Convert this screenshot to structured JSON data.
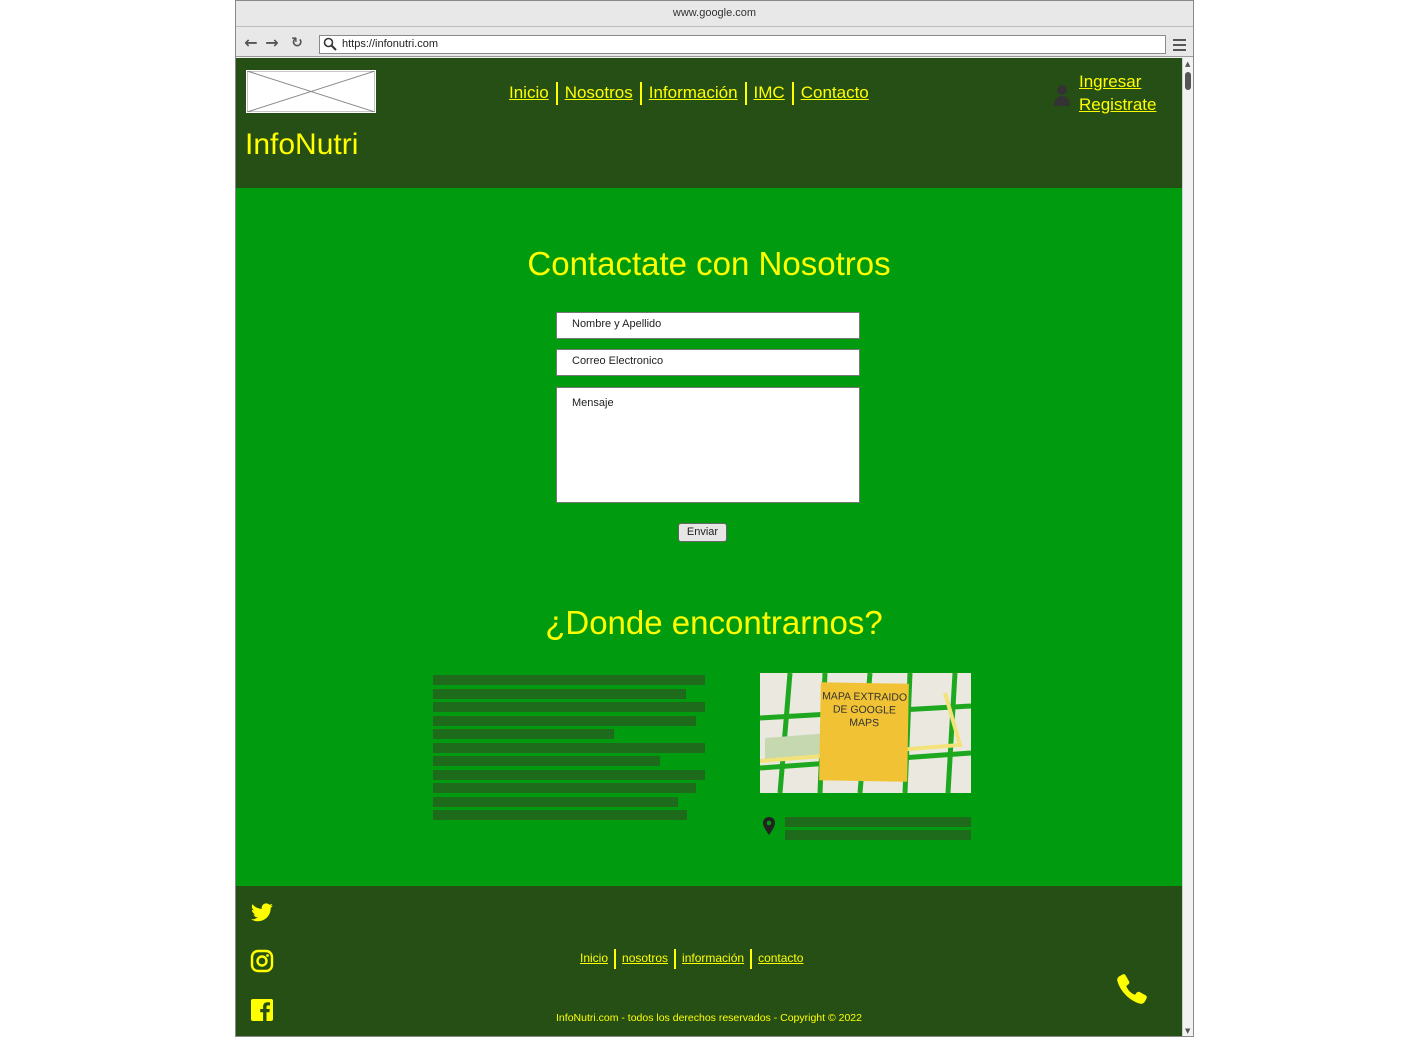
{
  "browser": {
    "window_title": "www.google.com",
    "url": "https://infonutri.com"
  },
  "header": {
    "brand": "InfoNutri",
    "nav": [
      "Inicio",
      "Nosotros",
      "Información",
      "IMC",
      "Contacto"
    ],
    "login": "Ingresar",
    "register": "Registrate"
  },
  "contact": {
    "title": "Contactate con Nosotros",
    "name_placeholder": "Nombre y Apellido",
    "email_placeholder": "Correo Electronico",
    "message_placeholder": "Mensaje",
    "send_label": "Enviar"
  },
  "location": {
    "title": "¿Donde encontrarnos?",
    "map_note": "MAPA EXTRAIDO DE GOOGLE MAPS"
  },
  "footer": {
    "nav": [
      "Inicio",
      "nosotros",
      "información",
      "contacto"
    ],
    "copyright": "InfoNutri.com - todos los derechos reservados - Copyright © 2022"
  },
  "colors": {
    "accent": "#ffff00",
    "header_bg": "#264f15",
    "page_bg": "#009b0e"
  }
}
